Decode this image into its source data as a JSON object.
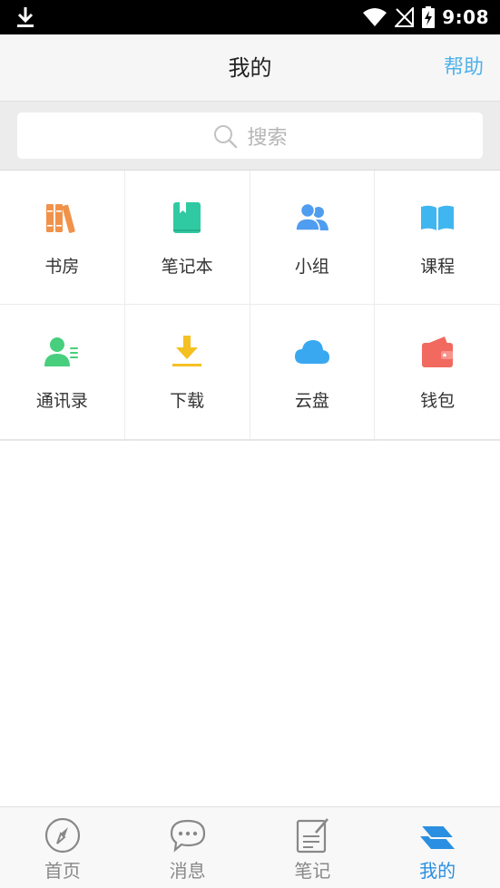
{
  "status_bar": {
    "time": "9:08",
    "icons": [
      "download-icon",
      "wifi-icon",
      "no-signal-icon",
      "battery-charging-icon"
    ]
  },
  "header": {
    "title": "我的",
    "help_label": "帮助"
  },
  "search": {
    "placeholder": "搜索"
  },
  "grid": {
    "items": [
      {
        "label": "书房",
        "icon": "bookshelf-icon",
        "color": "#f0924a"
      },
      {
        "label": "笔记本",
        "icon": "notebook-icon",
        "color": "#2fcaa1"
      },
      {
        "label": "小组",
        "icon": "group-icon",
        "color": "#4f9df0"
      },
      {
        "label": "课程",
        "icon": "open-book-icon",
        "color": "#3fb6ef"
      },
      {
        "label": "通讯录",
        "icon": "contacts-icon",
        "color": "#47cf7e"
      },
      {
        "label": "下载",
        "icon": "download-icon",
        "color": "#f5c022"
      },
      {
        "label": "云盘",
        "icon": "cloud-icon",
        "color": "#3aa8f0"
      },
      {
        "label": "钱包",
        "icon": "wallet-icon",
        "color": "#f26a5f"
      }
    ]
  },
  "tabbar": {
    "tabs": [
      {
        "label": "首页",
        "icon": "compass-icon",
        "active": false
      },
      {
        "label": "消息",
        "icon": "chat-bubble-icon",
        "active": false
      },
      {
        "label": "笔记",
        "icon": "note-edit-icon",
        "active": false
      },
      {
        "label": "我的",
        "icon": "layers-icon",
        "active": true
      }
    ],
    "active_color": "#2a8fe0",
    "inactive_color": "#888888"
  }
}
